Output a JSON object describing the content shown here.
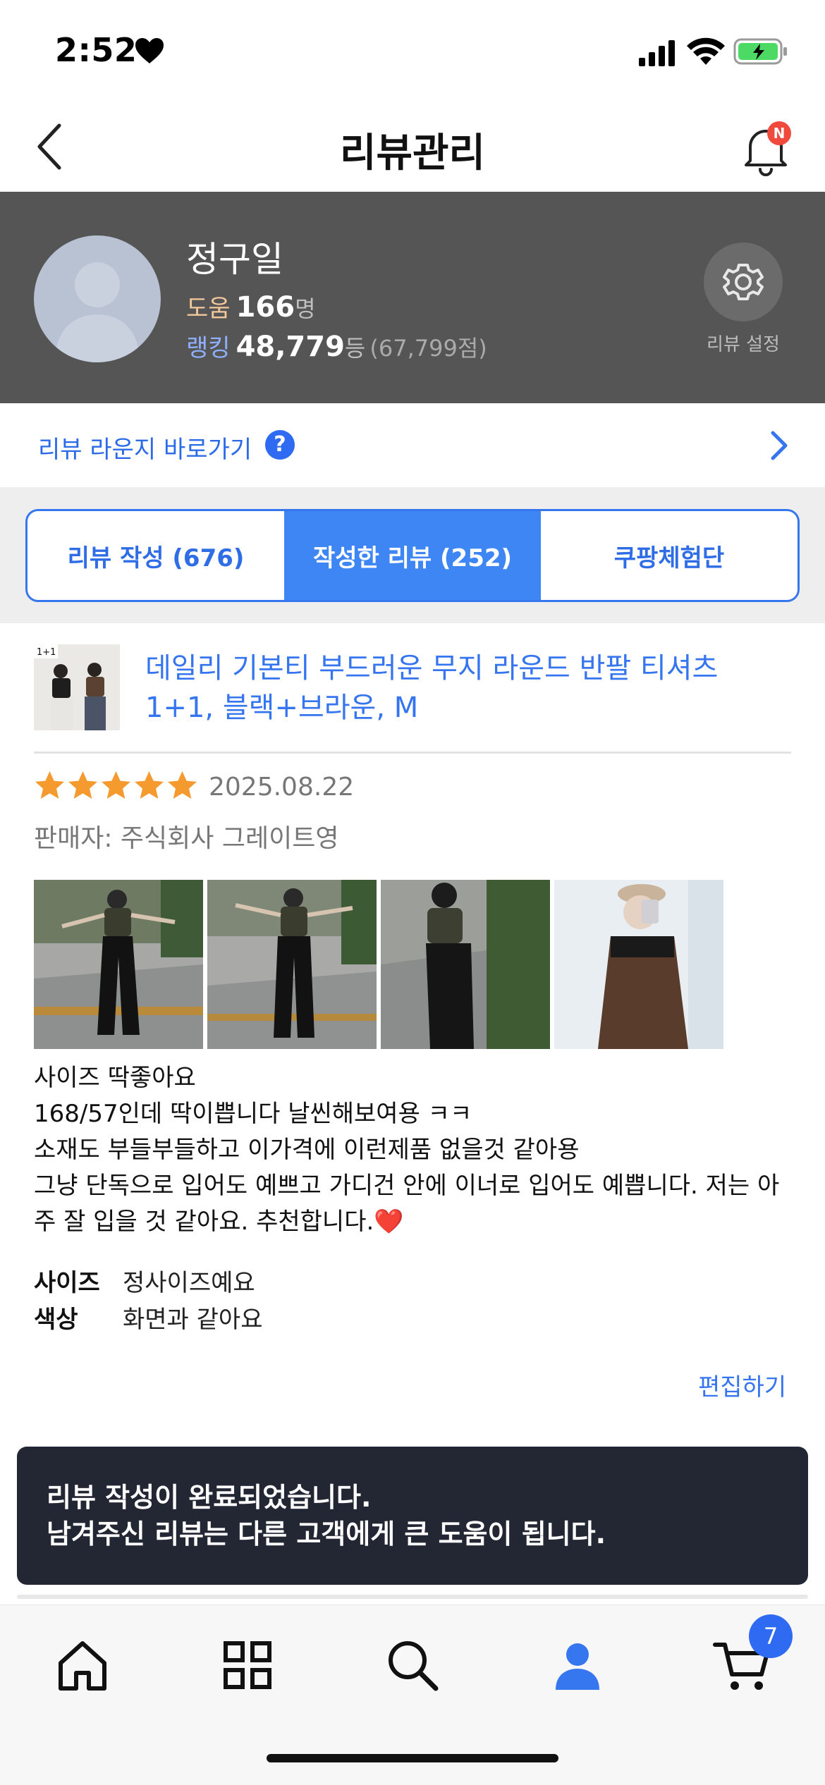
{
  "status_bar": {
    "time": "2:52"
  },
  "header": {
    "title": "리뷰관리",
    "notification_badge": "N"
  },
  "profile": {
    "name": "정구일",
    "help_label": "도움",
    "help_count": "166",
    "help_unit": "명",
    "rank_label": "랭킹",
    "rank_value": "48,779",
    "rank_unit": "등",
    "rank_points": "(67,799점)",
    "settings_label": "리뷰 설정"
  },
  "lounge": {
    "text": "리뷰 라운지 바로가기",
    "help_icon": "?"
  },
  "tabs": [
    {
      "label": "리뷰 작성 (676)",
      "active": false
    },
    {
      "label": "작성한 리뷰 (252)",
      "active": true
    },
    {
      "label": "쿠팡체험단",
      "active": false
    }
  ],
  "product": {
    "thumb_badge": "1+1",
    "title": "데일리 기본티 부드러운 무지 라운드 반팔 티셔츠 1+1, 블랙+브라운, M"
  },
  "review": {
    "rating": 5,
    "date": "2025.08.22",
    "seller": "판매자: 주식회사 그레이트영",
    "text_lines": [
      "사이즈 딱좋아요",
      "168/57인데 딱이쁩니다 날씬해보여용 ㅋㅋ",
      "소재도 부들부들하고 이가격에 이런제품 없을것 같아용",
      "그냥 단독으로 입어도 예쁘고 가디건 안에 이너로 입어도 예쁩니다. 저는 아주 잘 입을 것 같아요. 추천합니다.❤️"
    ],
    "attributes": [
      {
        "key": "사이즈",
        "value": "정사이즈예요"
      },
      {
        "key": "색상",
        "value": "화면과 같아요"
      }
    ],
    "edit_label": "편집하기"
  },
  "toast": {
    "line1": "리뷰 작성이 완료되었습니다.",
    "line2": "남겨주신 리뷰는 다른 고객에게 큰 도움이 됩니다."
  },
  "bottom_nav": {
    "items": [
      "home-icon",
      "category-icon",
      "search-icon",
      "profile-icon",
      "cart-icon"
    ],
    "cart_count": "7",
    "active_color": "#3677f0"
  },
  "colors": {
    "accent": "#3677f0",
    "star": "#f59a2f",
    "profile_bg": "#555555",
    "toast_bg": "#232733"
  }
}
